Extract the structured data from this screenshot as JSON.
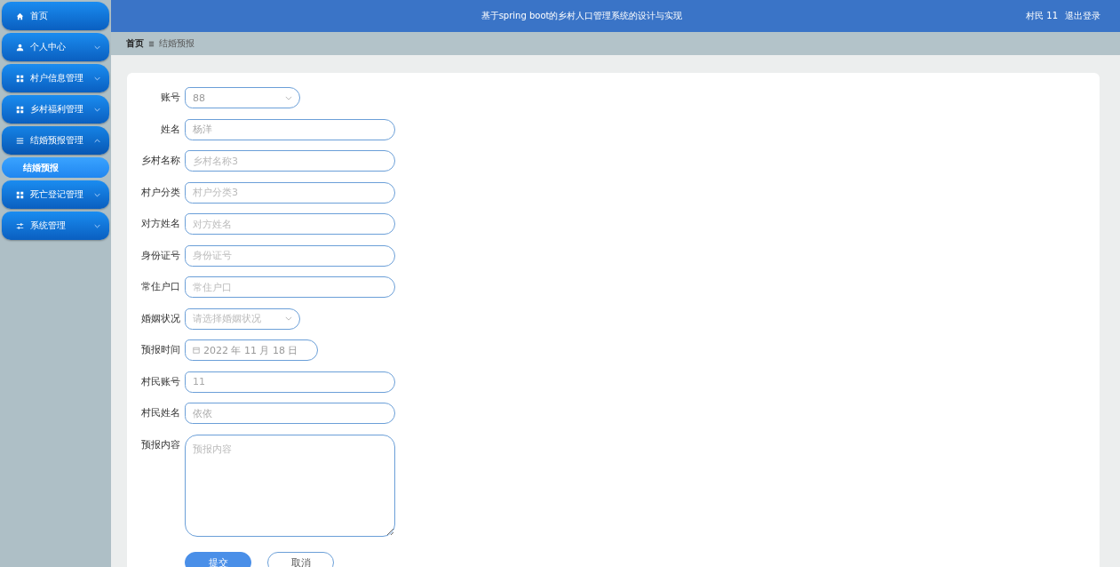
{
  "sidebar": {
    "items": [
      {
        "label": "首页"
      },
      {
        "label": "个人中心",
        "expanded": false
      },
      {
        "label": "村户信息管理",
        "expanded": false
      },
      {
        "label": "乡村福利管理",
        "expanded": false
      },
      {
        "label": "结婚预报管理",
        "expanded": true,
        "children": [
          {
            "label": "结婚预报",
            "selected": true
          }
        ]
      },
      {
        "label": "死亡登记管理",
        "expanded": false
      },
      {
        "label": "系统管理",
        "expanded": false
      }
    ]
  },
  "header": {
    "title": "基于spring boot的乡村人口管理系统的设计与实现",
    "user": "村民 11",
    "logout": "退出登录"
  },
  "breadcrumb": [
    "首页",
    "结婚预报"
  ],
  "form": {
    "fields": [
      {
        "kind": "select",
        "label": "账号",
        "value": "88"
      },
      {
        "kind": "input",
        "label": "姓名",
        "value": "杨洋"
      },
      {
        "kind": "input",
        "label": "乡村名称",
        "placeholder": "乡村名称3"
      },
      {
        "kind": "input",
        "label": "村户分类",
        "placeholder": "村户分类3"
      },
      {
        "kind": "input",
        "label": "对方姓名",
        "placeholder": "对方姓名"
      },
      {
        "kind": "input",
        "label": "身份证号",
        "placeholder": "身份证号"
      },
      {
        "kind": "input",
        "label": "常住户口",
        "placeholder": "常住户口"
      },
      {
        "kind": "select",
        "label": "婚姻状况",
        "placeholder": "请选择婚姻状况"
      },
      {
        "kind": "date",
        "label": "预报时间",
        "value": "2022 年 11 月 18 日"
      },
      {
        "kind": "input",
        "label": "村民账号",
        "value": "11"
      },
      {
        "kind": "input",
        "label": "村民姓名",
        "value": "依依"
      },
      {
        "kind": "textarea",
        "label": "预报内容",
        "placeholder": "预报内容"
      }
    ],
    "buttons": [
      {
        "label": "提交",
        "kind": "primary"
      },
      {
        "label": "取消",
        "kind": "plain"
      }
    ]
  }
}
